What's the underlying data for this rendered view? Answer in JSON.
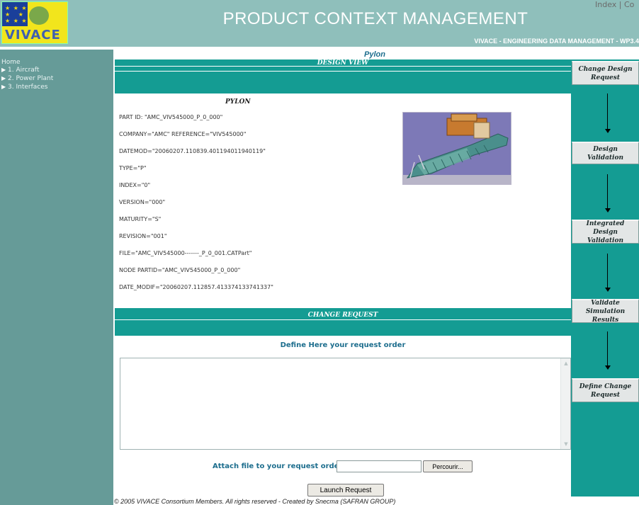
{
  "header": {
    "logo_text": "VIVACE",
    "index_link": "Index | Co",
    "title": "PRODUCT CONTEXT MANAGEMENT",
    "subtitle": "VIVACE - ENGINEERING DATA MANAGEMENT - WP3.4"
  },
  "sidebar": {
    "home": "Home",
    "items": [
      {
        "label": "1. Aircraft"
      },
      {
        "label": "2. Power Plant"
      },
      {
        "label": "3. Interfaces"
      }
    ]
  },
  "main": {
    "breadcrumb": "Pylon",
    "design_view_title": "DESIGN VIEW",
    "part_title": "PYLON",
    "fields": [
      "PART ID: \"AMC_VIV545000_P_0_000\"",
      "COMPANY=\"AMC\" REFERENCE=\"VIV545000\"",
      "DATEMOD=\"20060207.110839.401194011940119\"",
      "TYPE=\"P\"",
      "INDEX=\"0\"",
      "VERSION=\"000\"",
      "MATURITY=\"S\"",
      "REVISION=\"001\"",
      "FILE=\"AMC_VIV545000-------_P_0_001.CATPart\"",
      "NODE PARTID=\"AMC_VIV545000_P_0_000\"",
      "DATE_MODIF=\"20060207.112857.413374133741337\""
    ],
    "change_request_title": "CHANGE REQUEST",
    "request_prompt": "Define Here your request order",
    "request_text": "",
    "attach_label": "Attach file to your request order",
    "attach_value": "",
    "browse_label": "Percourir...",
    "launch_label": "Launch Request",
    "footer": "© 2005 VIVACE Consortium Members. All rights reserved - Created by Snecma (SAFRAN GROUP)"
  },
  "workflow": {
    "steps": [
      {
        "label": "Change Design Request"
      },
      {
        "label": "Design Validation"
      },
      {
        "label": "Integrated Design Validation"
      },
      {
        "label": "Validate Simulation Results"
      },
      {
        "label": "Define Change Request"
      }
    ]
  },
  "colors": {
    "header": "#8fbfbb",
    "sidebar": "#669b98",
    "band": "#149c93",
    "accent_text": "#1c6d8d"
  },
  "icons": [
    "eu-flag-logo",
    "menu-arrow-icon",
    "scroll-up-icon",
    "scroll-down-icon",
    "down-arrow-icon"
  ]
}
